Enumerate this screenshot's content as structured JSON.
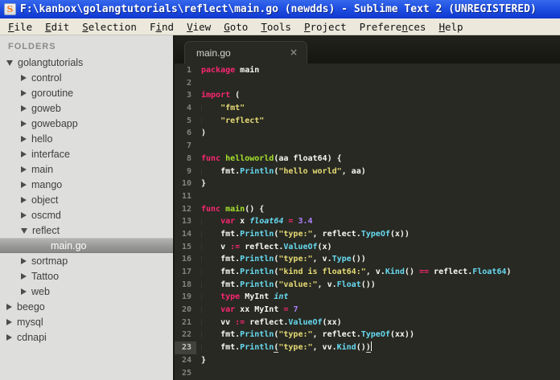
{
  "window": {
    "title": "F:\\kanbox\\golangtutorials\\reflect\\main.go (newdds) - Sublime Text 2 (UNREGISTERED)",
    "icon": "sublime-s-logo",
    "icon_letter": "S"
  },
  "menu": [
    {
      "label": "File",
      "u": 0
    },
    {
      "label": "Edit",
      "u": 0
    },
    {
      "label": "Selection",
      "u": 0
    },
    {
      "label": "Find",
      "u": 1
    },
    {
      "label": "View",
      "u": 0
    },
    {
      "label": "Goto",
      "u": 0
    },
    {
      "label": "Tools",
      "u": 0
    },
    {
      "label": "Project",
      "u": 0
    },
    {
      "label": "Preferences",
      "u": 7
    },
    {
      "label": "Help",
      "u": 0
    }
  ],
  "sidebar": {
    "header": "FOLDERS",
    "items": [
      {
        "label": "golangtutorials",
        "level": 0,
        "kind": "folder",
        "state": "expanded"
      },
      {
        "label": "control",
        "level": 1,
        "kind": "folder",
        "state": "collapsed"
      },
      {
        "label": "goroutine",
        "level": 1,
        "kind": "folder",
        "state": "collapsed"
      },
      {
        "label": "goweb",
        "level": 1,
        "kind": "folder",
        "state": "collapsed"
      },
      {
        "label": "gowebapp",
        "level": 1,
        "kind": "folder",
        "state": "collapsed"
      },
      {
        "label": "hello",
        "level": 1,
        "kind": "folder",
        "state": "collapsed"
      },
      {
        "label": "interface",
        "level": 1,
        "kind": "folder",
        "state": "collapsed"
      },
      {
        "label": "main",
        "level": 1,
        "kind": "folder",
        "state": "collapsed"
      },
      {
        "label": "mango",
        "level": 1,
        "kind": "folder",
        "state": "collapsed"
      },
      {
        "label": "object",
        "level": 1,
        "kind": "folder",
        "state": "collapsed"
      },
      {
        "label": "oscmd",
        "level": 1,
        "kind": "folder",
        "state": "collapsed"
      },
      {
        "label": "reflect",
        "level": 1,
        "kind": "folder",
        "state": "expanded"
      },
      {
        "label": "main.go",
        "level": 2,
        "kind": "file",
        "selected": true
      },
      {
        "label": "sortmap",
        "level": 1,
        "kind": "folder",
        "state": "collapsed"
      },
      {
        "label": "Tattoo",
        "level": 1,
        "kind": "folder",
        "state": "collapsed"
      },
      {
        "label": "web",
        "level": 1,
        "kind": "folder",
        "state": "collapsed"
      },
      {
        "label": "beego",
        "level": 0,
        "kind": "folder",
        "state": "collapsed"
      },
      {
        "label": "mysql",
        "level": 0,
        "kind": "folder",
        "state": "collapsed"
      },
      {
        "label": "cdnapi",
        "level": 0,
        "kind": "folder",
        "state": "collapsed"
      }
    ]
  },
  "icons": {
    "window_icon": "sublime-s-logo",
    "tab_close": "close-icon",
    "folder_collapsed": "right-triangle",
    "folder_expanded": "down-triangle"
  },
  "theme": {
    "titlebar_blue": "#2050e2",
    "editor_bg": "#282923",
    "sidebar_bg": "#DEDEDC",
    "keyword": "#F92672",
    "string": "#E6DB74",
    "number": "#AE81FF",
    "function_def": "#A6E22E",
    "support_function": "#66D9EF",
    "type_italic": "#66D9EF",
    "plain": "#F8F8F2",
    "gutter": "#83847c"
  },
  "editor": {
    "tab_label": "main.go",
    "tab_close": "×",
    "current_line": 23,
    "lines": [
      {
        "n": 1,
        "s": [
          [
            "kw",
            "package"
          ],
          [
            "pl",
            " main"
          ]
        ]
      },
      {
        "n": 2,
        "s": []
      },
      {
        "n": 3,
        "s": [
          [
            "kw",
            "import"
          ],
          [
            "pl",
            " ("
          ]
        ]
      },
      {
        "n": 4,
        "s": [
          [
            "pl",
            "    "
          ],
          [
            "st",
            "\"fmt\""
          ]
        ]
      },
      {
        "n": 5,
        "s": [
          [
            "pl",
            "    "
          ],
          [
            "st",
            "\"reflect\""
          ]
        ]
      },
      {
        "n": 6,
        "s": [
          [
            "pl",
            ")"
          ]
        ]
      },
      {
        "n": 7,
        "s": []
      },
      {
        "n": 8,
        "s": [
          [
            "kw",
            "func"
          ],
          [
            "pl",
            " "
          ],
          [
            "fn",
            "helloworld"
          ],
          [
            "pl",
            "(aa float64) {"
          ]
        ]
      },
      {
        "n": 9,
        "s": [
          [
            "pl",
            "    fmt."
          ],
          [
            "su",
            "Println"
          ],
          [
            "pl",
            "("
          ],
          [
            "st",
            "\"hello world\""
          ],
          [
            "pl",
            ", aa)"
          ]
        ]
      },
      {
        "n": 10,
        "s": [
          [
            "pl",
            "}"
          ]
        ]
      },
      {
        "n": 11,
        "s": []
      },
      {
        "n": 12,
        "s": [
          [
            "kw",
            "func"
          ],
          [
            "pl",
            " "
          ],
          [
            "fn",
            "main"
          ],
          [
            "pl",
            "() {"
          ]
        ]
      },
      {
        "n": 13,
        "s": [
          [
            "pl",
            "    "
          ],
          [
            "kw",
            "var"
          ],
          [
            "pl",
            " x "
          ],
          [
            "ty",
            "float64"
          ],
          [
            "pl",
            " "
          ],
          [
            "kw",
            "="
          ],
          [
            "pl",
            " "
          ],
          [
            "nu",
            "3.4"
          ]
        ]
      },
      {
        "n": 14,
        "s": [
          [
            "pl",
            "    fmt."
          ],
          [
            "su",
            "Println"
          ],
          [
            "pl",
            "("
          ],
          [
            "st",
            "\"type:\""
          ],
          [
            "pl",
            ", reflect."
          ],
          [
            "su",
            "TypeOf"
          ],
          [
            "pl",
            "(x))"
          ]
        ]
      },
      {
        "n": 15,
        "s": [
          [
            "pl",
            "    v "
          ],
          [
            "kw",
            ":="
          ],
          [
            "pl",
            " reflect."
          ],
          [
            "su",
            "ValueOf"
          ],
          [
            "pl",
            "(x)"
          ]
        ]
      },
      {
        "n": 16,
        "s": [
          [
            "pl",
            "    fmt."
          ],
          [
            "su",
            "Println"
          ],
          [
            "pl",
            "("
          ],
          [
            "st",
            "\"type:\""
          ],
          [
            "pl",
            ", v."
          ],
          [
            "su",
            "Type"
          ],
          [
            "pl",
            "())"
          ]
        ]
      },
      {
        "n": 17,
        "s": [
          [
            "pl",
            "    fmt."
          ],
          [
            "su",
            "Println"
          ],
          [
            "pl",
            "("
          ],
          [
            "st",
            "\"kind is float64:\""
          ],
          [
            "pl",
            ", v."
          ],
          [
            "su",
            "Kind"
          ],
          [
            "pl",
            "() "
          ],
          [
            "kw",
            "=="
          ],
          [
            "pl",
            " reflect."
          ],
          [
            "su",
            "Float64"
          ],
          [
            "pl",
            ")"
          ]
        ]
      },
      {
        "n": 18,
        "s": [
          [
            "pl",
            "    fmt."
          ],
          [
            "su",
            "Println"
          ],
          [
            "pl",
            "("
          ],
          [
            "st",
            "\"value:\""
          ],
          [
            "pl",
            ", v."
          ],
          [
            "su",
            "Float"
          ],
          [
            "pl",
            "())"
          ]
        ]
      },
      {
        "n": 19,
        "s": [
          [
            "pl",
            "    "
          ],
          [
            "kw",
            "type"
          ],
          [
            "pl",
            " MyInt "
          ],
          [
            "ty",
            "int"
          ]
        ]
      },
      {
        "n": 20,
        "s": [
          [
            "pl",
            "    "
          ],
          [
            "kw",
            "var"
          ],
          [
            "pl",
            " xx MyInt "
          ],
          [
            "kw",
            "="
          ],
          [
            "pl",
            " "
          ],
          [
            "nu",
            "7"
          ]
        ]
      },
      {
        "n": 21,
        "s": [
          [
            "pl",
            "    vv "
          ],
          [
            "kw",
            ":="
          ],
          [
            "pl",
            " reflect."
          ],
          [
            "su",
            "ValueOf"
          ],
          [
            "pl",
            "(xx)"
          ]
        ]
      },
      {
        "n": 22,
        "s": [
          [
            "pl",
            "    fmt."
          ],
          [
            "su",
            "Println"
          ],
          [
            "pl",
            "("
          ],
          [
            "st",
            "\"type:\""
          ],
          [
            "pl",
            ", reflect."
          ],
          [
            "su",
            "TypeOf"
          ],
          [
            "pl",
            "(xx))"
          ]
        ]
      },
      {
        "n": 23,
        "s": [
          [
            "pl",
            "    fmt."
          ],
          [
            "su",
            "Println"
          ],
          [
            "plu",
            "("
          ],
          [
            "st",
            "\"type:\""
          ],
          [
            "pl",
            ", vv."
          ],
          [
            "su",
            "Kind"
          ],
          [
            "pl",
            "()"
          ],
          [
            "plu",
            ")"
          ],
          [
            "cur",
            ""
          ]
        ]
      },
      {
        "n": 24,
        "s": [
          [
            "pl",
            "}"
          ]
        ]
      },
      {
        "n": 25,
        "s": []
      }
    ]
  }
}
